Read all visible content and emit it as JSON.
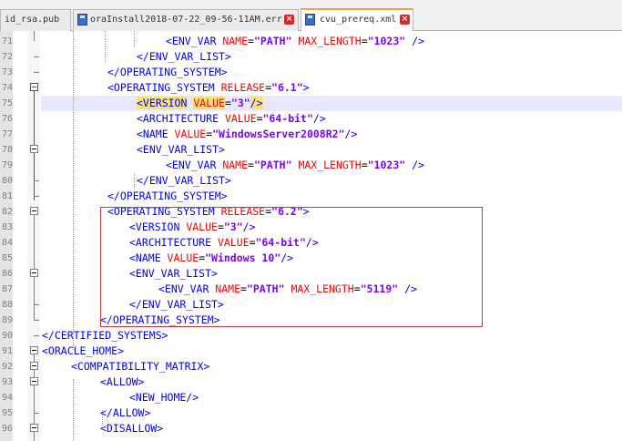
{
  "tabs": [
    {
      "label": "id_rsa.pub",
      "active": false
    },
    {
      "label": "oraInstall2018-07-22_09-56-11AM.err",
      "active": false
    },
    {
      "label": "cvu_prereq.xml",
      "active": true
    }
  ],
  "colors": {
    "tag": "#0000ff",
    "attribute": "#ff0000",
    "value": "#8000ff",
    "current_line": "#e8e8ff",
    "highlight_box": "#d33a3a",
    "selection": "#f7e27a"
  },
  "line_numbers": [
    "71",
    "72",
    "73",
    "74",
    "75",
    "76",
    "77",
    "78",
    "79",
    "80",
    "81",
    "82",
    "83",
    "84",
    "85",
    "86",
    "87",
    "88",
    "89",
    "90",
    "91",
    "92",
    "93",
    "94",
    "95",
    "96"
  ],
  "code": {
    "l71": {
      "open": "<ENV_VAR ",
      "a1": "NAME",
      "v1": "\"PATH\"",
      "a2": "MAX_LENGTH",
      "v2": "\"1023\"",
      "close": " />"
    },
    "l72": {
      "text": "</ENV_VAR_LIST>"
    },
    "l73": {
      "text": "</OPERATING_SYSTEM>"
    },
    "l74": {
      "open": "<OPERATING_SYSTEM ",
      "a1": "RELEASE",
      "v1": "\"6.1\"",
      "close": ">"
    },
    "l75": {
      "open": "<VERSION",
      "a1": "VALUE",
      "v1": "\"3\"",
      "close": "/>"
    },
    "l76": {
      "open": "<ARCHITECTURE ",
      "a1": "VALUE",
      "v1": "\"64-bit\"",
      "close": "/>"
    },
    "l77": {
      "open": "<NAME ",
      "a1": "VALUE",
      "v1": "\"WindowsServer2008R2\"",
      "close": "/>"
    },
    "l78": {
      "text": "<ENV_VAR_LIST>"
    },
    "l79": {
      "open": "<ENV_VAR ",
      "a1": "NAME",
      "v1": "\"PATH\"",
      "a2": "MAX_LENGTH",
      "v2": "\"1023\"",
      "close": " />"
    },
    "l80": {
      "text": "</ENV_VAR_LIST>"
    },
    "l81": {
      "text": "</OPERATING_SYSTEM>"
    },
    "l82": {
      "open": "<OPERATING_SYSTEM ",
      "a1": "RELEASE",
      "v1": "\"6.2\"",
      "close": ">"
    },
    "l83": {
      "open": "<VERSION ",
      "a1": "VALUE",
      "v1": "\"3\"",
      "close": "/>"
    },
    "l84": {
      "open": "<ARCHITECTURE ",
      "a1": "VALUE",
      "v1": "\"64-bit\"",
      "close": "/>"
    },
    "l85": {
      "open": "<NAME ",
      "a1": "VALUE",
      "v1": "\"Windows 10\"",
      "close": "/>"
    },
    "l86": {
      "text": "<ENV_VAR_LIST>"
    },
    "l87": {
      "open": "<ENV_VAR ",
      "a1": "NAME",
      "v1": "\"PATH\"",
      "a2": "MAX_LENGTH",
      "v2": "\"5119\"",
      "close": " />"
    },
    "l88": {
      "text": "</ENV_VAR_LIST>"
    },
    "l89": {
      "text": "</OPERATING_SYSTEM>"
    },
    "l90": {
      "text": "</CERTIFIED_SYSTEMS>"
    },
    "l91": {
      "text": "<ORACLE_HOME>"
    },
    "l92": {
      "text": "<COMPATIBILITY_MATRIX>"
    },
    "l93": {
      "text": "<ALLOW>"
    },
    "l94": {
      "text": "<NEW_HOME/>"
    },
    "l95": {
      "text": "</ALLOW>"
    },
    "l96": {
      "text": "<DISALLOW>"
    }
  }
}
